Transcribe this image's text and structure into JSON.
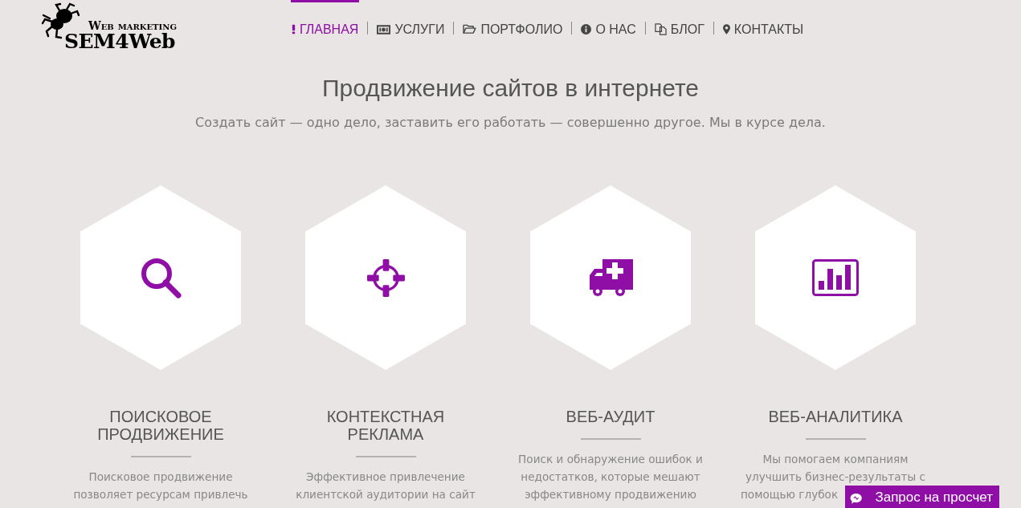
{
  "logo": {
    "tagline": "Web marketing",
    "name": "SEM4Web"
  },
  "nav": [
    {
      "label": "ГЛАВНАЯ",
      "selected": true
    },
    {
      "label": "УСЛУГИ",
      "selected": false
    },
    {
      "label": "ПОРТФОЛИО",
      "selected": false
    },
    {
      "label": "О НАС",
      "selected": false
    },
    {
      "label": "БЛОГ",
      "selected": false
    },
    {
      "label": "КОНТАКТЫ",
      "selected": false
    }
  ],
  "hero": {
    "title": "Продвижение сайтов в интернете",
    "subtitle": "Создать сайт — одно дело, заставить его работать — совершенно другое. Мы в курсе дела."
  },
  "services": [
    {
      "title": [
        "ПОИСКОВОЕ",
        "ПРОДВИЖЕНИЕ"
      ],
      "description": [
        "Поисковое продвижение",
        "позволяет ресурсам привлечь"
      ]
    },
    {
      "title": [
        "КОНТЕКСТНАЯ",
        "РЕКЛАМА"
      ],
      "description": [
        "Эффективное привлечение",
        "клиентской аудитории на сайт"
      ]
    },
    {
      "title": [
        "ВЕБ-АУДИТ"
      ],
      "description": [
        "Поиск и обнаружение ошибок и",
        "недостатков, которые мешают",
        "эффективному продвижению"
      ]
    },
    {
      "title": [
        "ВЕБ-АНАЛИТИКА"
      ],
      "description": [
        "Мы помогаем компаниям",
        "улучшить бизнес-результаты с",
        "помощью глубок"
      ]
    }
  ],
  "request_button": {
    "label": "Запрос на просчет"
  }
}
